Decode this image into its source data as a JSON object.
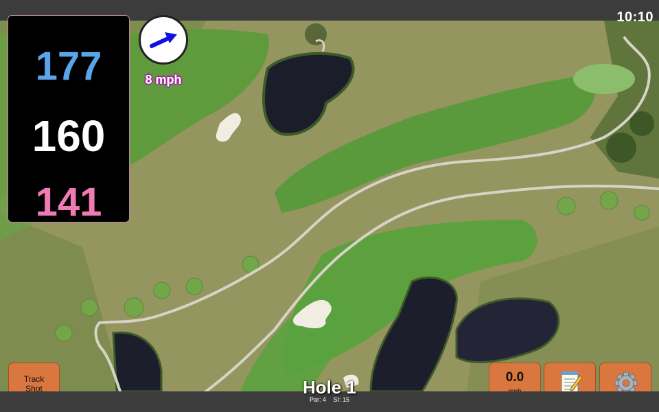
{
  "status_bar": {
    "time": "10:10"
  },
  "distances": {
    "back": "177",
    "middle": "160",
    "front": "141"
  },
  "wind": {
    "speed": "8 mph",
    "icon": "arrow-icon"
  },
  "buttons": {
    "track_shot": {
      "line1": "Track",
      "line2": "Shot"
    },
    "speed": {
      "value": "0.0",
      "unit": "mph"
    },
    "notes_icon": "notepad-icon",
    "settings_icon": "gear-icon"
  },
  "hole": {
    "title": "Hole 1",
    "par": "Par: 4",
    "si": "SI: 15"
  },
  "colors": {
    "back": "#5aa4ea",
    "middle": "#ffffff",
    "front": "#f07ab4",
    "button": "#d9773e",
    "wind_arrow": "#1010e0"
  }
}
